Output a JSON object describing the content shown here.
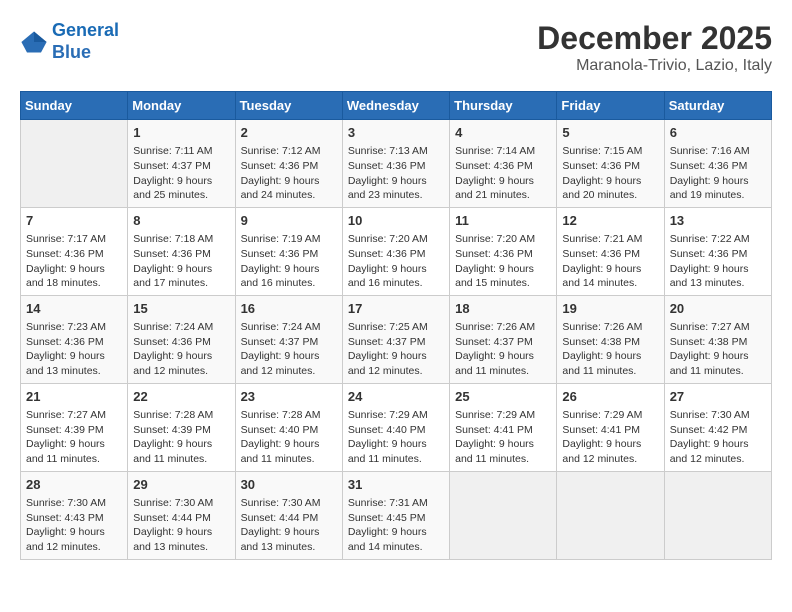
{
  "logo": {
    "line1": "General",
    "line2": "Blue"
  },
  "title": "December 2025",
  "location": "Maranola-Trivio, Lazio, Italy",
  "weekdays": [
    "Sunday",
    "Monday",
    "Tuesday",
    "Wednesday",
    "Thursday",
    "Friday",
    "Saturday"
  ],
  "weeks": [
    [
      {
        "day": "",
        "info": ""
      },
      {
        "day": "1",
        "info": "Sunrise: 7:11 AM\nSunset: 4:37 PM\nDaylight: 9 hours\nand 25 minutes."
      },
      {
        "day": "2",
        "info": "Sunrise: 7:12 AM\nSunset: 4:36 PM\nDaylight: 9 hours\nand 24 minutes."
      },
      {
        "day": "3",
        "info": "Sunrise: 7:13 AM\nSunset: 4:36 PM\nDaylight: 9 hours\nand 23 minutes."
      },
      {
        "day": "4",
        "info": "Sunrise: 7:14 AM\nSunset: 4:36 PM\nDaylight: 9 hours\nand 21 minutes."
      },
      {
        "day": "5",
        "info": "Sunrise: 7:15 AM\nSunset: 4:36 PM\nDaylight: 9 hours\nand 20 minutes."
      },
      {
        "day": "6",
        "info": "Sunrise: 7:16 AM\nSunset: 4:36 PM\nDaylight: 9 hours\nand 19 minutes."
      }
    ],
    [
      {
        "day": "7",
        "info": "Sunrise: 7:17 AM\nSunset: 4:36 PM\nDaylight: 9 hours\nand 18 minutes."
      },
      {
        "day": "8",
        "info": "Sunrise: 7:18 AM\nSunset: 4:36 PM\nDaylight: 9 hours\nand 17 minutes."
      },
      {
        "day": "9",
        "info": "Sunrise: 7:19 AM\nSunset: 4:36 PM\nDaylight: 9 hours\nand 16 minutes."
      },
      {
        "day": "10",
        "info": "Sunrise: 7:20 AM\nSunset: 4:36 PM\nDaylight: 9 hours\nand 16 minutes."
      },
      {
        "day": "11",
        "info": "Sunrise: 7:20 AM\nSunset: 4:36 PM\nDaylight: 9 hours\nand 15 minutes."
      },
      {
        "day": "12",
        "info": "Sunrise: 7:21 AM\nSunset: 4:36 PM\nDaylight: 9 hours\nand 14 minutes."
      },
      {
        "day": "13",
        "info": "Sunrise: 7:22 AM\nSunset: 4:36 PM\nDaylight: 9 hours\nand 13 minutes."
      }
    ],
    [
      {
        "day": "14",
        "info": "Sunrise: 7:23 AM\nSunset: 4:36 PM\nDaylight: 9 hours\nand 13 minutes."
      },
      {
        "day": "15",
        "info": "Sunrise: 7:24 AM\nSunset: 4:36 PM\nDaylight: 9 hours\nand 12 minutes."
      },
      {
        "day": "16",
        "info": "Sunrise: 7:24 AM\nSunset: 4:37 PM\nDaylight: 9 hours\nand 12 minutes."
      },
      {
        "day": "17",
        "info": "Sunrise: 7:25 AM\nSunset: 4:37 PM\nDaylight: 9 hours\nand 12 minutes."
      },
      {
        "day": "18",
        "info": "Sunrise: 7:26 AM\nSunset: 4:37 PM\nDaylight: 9 hours\nand 11 minutes."
      },
      {
        "day": "19",
        "info": "Sunrise: 7:26 AM\nSunset: 4:38 PM\nDaylight: 9 hours\nand 11 minutes."
      },
      {
        "day": "20",
        "info": "Sunrise: 7:27 AM\nSunset: 4:38 PM\nDaylight: 9 hours\nand 11 minutes."
      }
    ],
    [
      {
        "day": "21",
        "info": "Sunrise: 7:27 AM\nSunset: 4:39 PM\nDaylight: 9 hours\nand 11 minutes."
      },
      {
        "day": "22",
        "info": "Sunrise: 7:28 AM\nSunset: 4:39 PM\nDaylight: 9 hours\nand 11 minutes."
      },
      {
        "day": "23",
        "info": "Sunrise: 7:28 AM\nSunset: 4:40 PM\nDaylight: 9 hours\nand 11 minutes."
      },
      {
        "day": "24",
        "info": "Sunrise: 7:29 AM\nSunset: 4:40 PM\nDaylight: 9 hours\nand 11 minutes."
      },
      {
        "day": "25",
        "info": "Sunrise: 7:29 AM\nSunset: 4:41 PM\nDaylight: 9 hours\nand 11 minutes."
      },
      {
        "day": "26",
        "info": "Sunrise: 7:29 AM\nSunset: 4:41 PM\nDaylight: 9 hours\nand 12 minutes."
      },
      {
        "day": "27",
        "info": "Sunrise: 7:30 AM\nSunset: 4:42 PM\nDaylight: 9 hours\nand 12 minutes."
      }
    ],
    [
      {
        "day": "28",
        "info": "Sunrise: 7:30 AM\nSunset: 4:43 PM\nDaylight: 9 hours\nand 12 minutes."
      },
      {
        "day": "29",
        "info": "Sunrise: 7:30 AM\nSunset: 4:44 PM\nDaylight: 9 hours\nand 13 minutes."
      },
      {
        "day": "30",
        "info": "Sunrise: 7:30 AM\nSunset: 4:44 PM\nDaylight: 9 hours\nand 13 minutes."
      },
      {
        "day": "31",
        "info": "Sunrise: 7:31 AM\nSunset: 4:45 PM\nDaylight: 9 hours\nand 14 minutes."
      },
      {
        "day": "",
        "info": ""
      },
      {
        "day": "",
        "info": ""
      },
      {
        "day": "",
        "info": ""
      }
    ]
  ]
}
